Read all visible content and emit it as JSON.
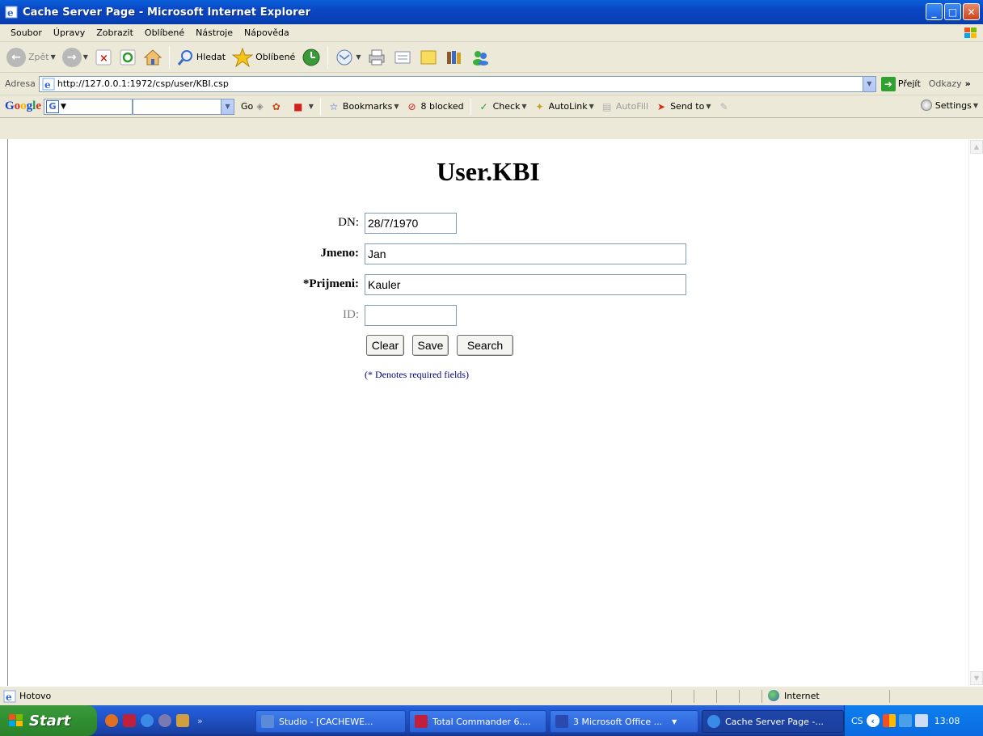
{
  "window": {
    "title": "Cache Server Page - Microsoft Internet Explorer",
    "buttons": {
      "minimize": "_",
      "maximize": "□",
      "close": "✕"
    }
  },
  "menu": [
    "Soubor",
    "Úpravy",
    "Zobrazit",
    "Oblíbené",
    "Nástroje",
    "Nápověda"
  ],
  "toolbar": {
    "back": "Zpět",
    "search": "Hledat",
    "favorites": "Oblíbené"
  },
  "address": {
    "label": "Adresa",
    "url": "http://127.0.0.1:1972/csp/user/KBI.csp",
    "go": "Přejít",
    "links": "Odkazy",
    "more": "»"
  },
  "google_toolbar": {
    "logo": "Google",
    "go": "Go",
    "bookmarks": "Bookmarks",
    "blocked": "8 blocked",
    "check": "Check",
    "autolink": "AutoLink",
    "autofill": "AutoFill",
    "send_to": "Send to",
    "settings": "Settings"
  },
  "page": {
    "title": "User.KBI",
    "fields": [
      {
        "label": "DN:",
        "value": "28/7/1970"
      },
      {
        "label": "Jmeno:",
        "value": "Jan"
      },
      {
        "label": "*Prijmeni:",
        "value": "Kauler"
      },
      {
        "label": "ID:",
        "value": ""
      }
    ],
    "buttons": {
      "clear": "Clear",
      "save": "Save",
      "search": "Search"
    },
    "note": "(* Denotes required fields)"
  },
  "status": {
    "text": "Hotovo",
    "zone": "Internet"
  },
  "taskbar": {
    "start": "Start",
    "tasks": [
      "Studio - [CACHEWE...",
      "Total Commander 6....",
      "3 Microsoft Office ...",
      "Cache Server Page -..."
    ],
    "lang": "CS",
    "clock": "13:08"
  }
}
